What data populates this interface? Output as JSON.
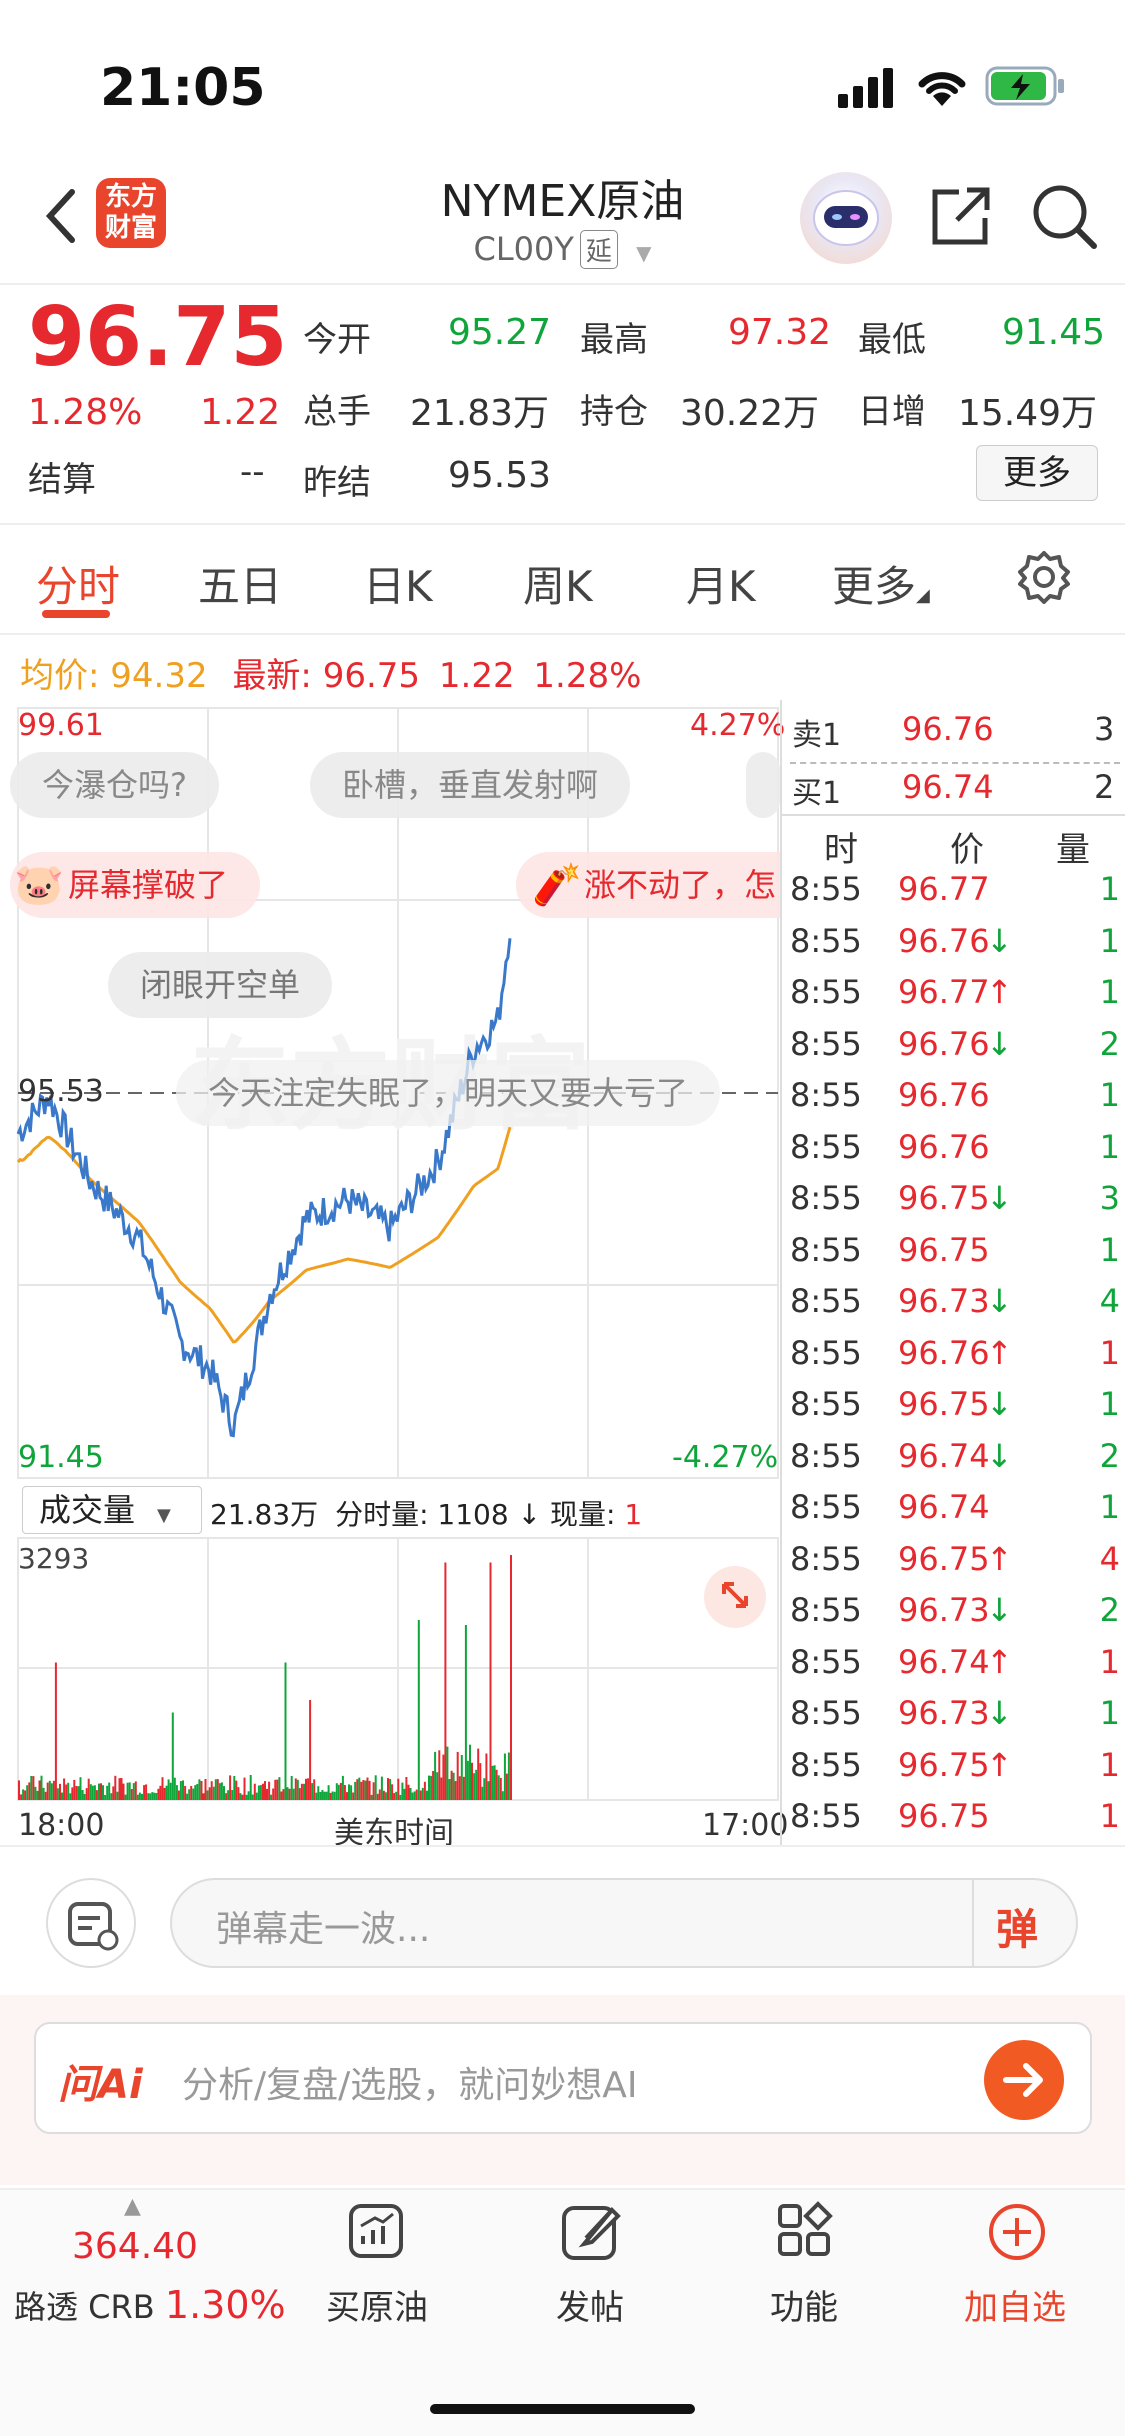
{
  "status_bar": {
    "time": "21:05"
  },
  "header": {
    "title": "NYMEX原油",
    "symbol": "CL00Y",
    "delay_tag": "延",
    "logo_text": "东方财富"
  },
  "quote": {
    "price": "96.75",
    "change_pct": "1.28%",
    "change": "1.22",
    "settle_label": "结算",
    "settle_value": "--",
    "open_label": "今开",
    "open_value": "95.27",
    "high_label": "最高",
    "high_value": "97.32",
    "low_label": "最低",
    "low_value": "91.45",
    "volume_label": "总手",
    "volume_value": "21.83万",
    "oi_label": "持仓",
    "oi_value": "30.22万",
    "daily_inc_label": "日增",
    "daily_inc_value": "15.49万",
    "prev_settle_label": "昨结",
    "prev_settle_value": "95.53",
    "more_label": "更多"
  },
  "tabs": [
    "分时",
    "五日",
    "日K",
    "周K",
    "月K",
    "更多"
  ],
  "chart_info": {
    "avg_label": "均价:",
    "avg_value": "94.32",
    "latest_label": "最新:",
    "latest_value": "96.75",
    "latest_change": "1.22",
    "latest_pct": "1.28%",
    "y_top": "99.61",
    "y_bottom": "91.45",
    "y_ref": "95.53",
    "pct_top": "4.27%",
    "pct_bottom": "-4.27%",
    "volume_selector": "成交量",
    "volume_total": "21.83万",
    "volume_info_label": "分时量:",
    "volume_info_value": "1108",
    "current_vol_label": "现量:",
    "current_vol_value": "1",
    "vol_max": "3293",
    "x_start": "18:00",
    "x_mid": "美东时间",
    "x_end": "17:00"
  },
  "danmaku": [
    "今瀑仓吗?",
    "卧槽，垂直发射啊",
    "屏幕撑破了",
    "涨不动了，怎",
    "闭眼开空单",
    "今天注定失眠了，明天又要大亏了"
  ],
  "orderbook": {
    "sell_label": "卖1",
    "sell_price": "96.76",
    "sell_vol": "3",
    "buy_label": "买1",
    "buy_price": "96.74",
    "buy_vol": "2",
    "col_time": "时",
    "col_price": "价",
    "col_vol": "量",
    "ticks": [
      {
        "t": "8:55",
        "p": "96.77",
        "d": "",
        "v": "1",
        "pc": "red",
        "vc": "green"
      },
      {
        "t": "8:55",
        "p": "96.76",
        "d": "↓",
        "v": "1",
        "pc": "red",
        "vc": "green"
      },
      {
        "t": "8:55",
        "p": "96.77",
        "d": "↑",
        "v": "1",
        "pc": "red",
        "vc": "green"
      },
      {
        "t": "8:55",
        "p": "96.76",
        "d": "↓",
        "v": "2",
        "pc": "red",
        "vc": "green"
      },
      {
        "t": "8:55",
        "p": "96.76",
        "d": "",
        "v": "1",
        "pc": "red",
        "vc": "green"
      },
      {
        "t": "8:55",
        "p": "96.76",
        "d": "",
        "v": "1",
        "pc": "red",
        "vc": "green"
      },
      {
        "t": "8:55",
        "p": "96.75",
        "d": "↓",
        "v": "3",
        "pc": "red",
        "vc": "green"
      },
      {
        "t": "8:55",
        "p": "96.75",
        "d": "",
        "v": "1",
        "pc": "red",
        "vc": "green"
      },
      {
        "t": "8:55",
        "p": "96.73",
        "d": "↓",
        "v": "4",
        "pc": "red",
        "vc": "green"
      },
      {
        "t": "8:55",
        "p": "96.76",
        "d": "↑",
        "v": "1",
        "pc": "red",
        "vc": "red"
      },
      {
        "t": "8:55",
        "p": "96.75",
        "d": "↓",
        "v": "1",
        "pc": "red",
        "vc": "green"
      },
      {
        "t": "8:55",
        "p": "96.74",
        "d": "↓",
        "v": "2",
        "pc": "red",
        "vc": "green"
      },
      {
        "t": "8:55",
        "p": "96.74",
        "d": "",
        "v": "1",
        "pc": "red",
        "vc": "green"
      },
      {
        "t": "8:55",
        "p": "96.75",
        "d": "↑",
        "v": "4",
        "pc": "red",
        "vc": "red"
      },
      {
        "t": "8:55",
        "p": "96.73",
        "d": "↓",
        "v": "2",
        "pc": "red",
        "vc": "green"
      },
      {
        "t": "8:55",
        "p": "96.74",
        "d": "↑",
        "v": "1",
        "pc": "red",
        "vc": "red"
      },
      {
        "t": "8:55",
        "p": "96.73",
        "d": "↓",
        "v": "1",
        "pc": "red",
        "vc": "green"
      },
      {
        "t": "8:55",
        "p": "96.75",
        "d": "↑",
        "v": "1",
        "pc": "red",
        "vc": "red"
      },
      {
        "t": "8:55",
        "p": "96.75",
        "d": "",
        "v": "1",
        "pc": "red",
        "vc": "red"
      }
    ]
  },
  "danmaku_input": {
    "placeholder": "弹幕走一波...",
    "button": "弹"
  },
  "ai": {
    "logo": "问Ai",
    "placeholder": "分析/复盘/选股，就问妙想AI"
  },
  "navbar": {
    "index_value": "364.40",
    "index_name": "路透 CRB",
    "index_pct": "1.30%",
    "items": [
      "买原油",
      "发帖",
      "功能",
      "加自选"
    ]
  },
  "colors": {
    "up": "#e5292f",
    "down": "#10a53a",
    "accent": "#e8452c",
    "price_line": "#3a78c9",
    "avg_line": "#f0a020"
  }
}
